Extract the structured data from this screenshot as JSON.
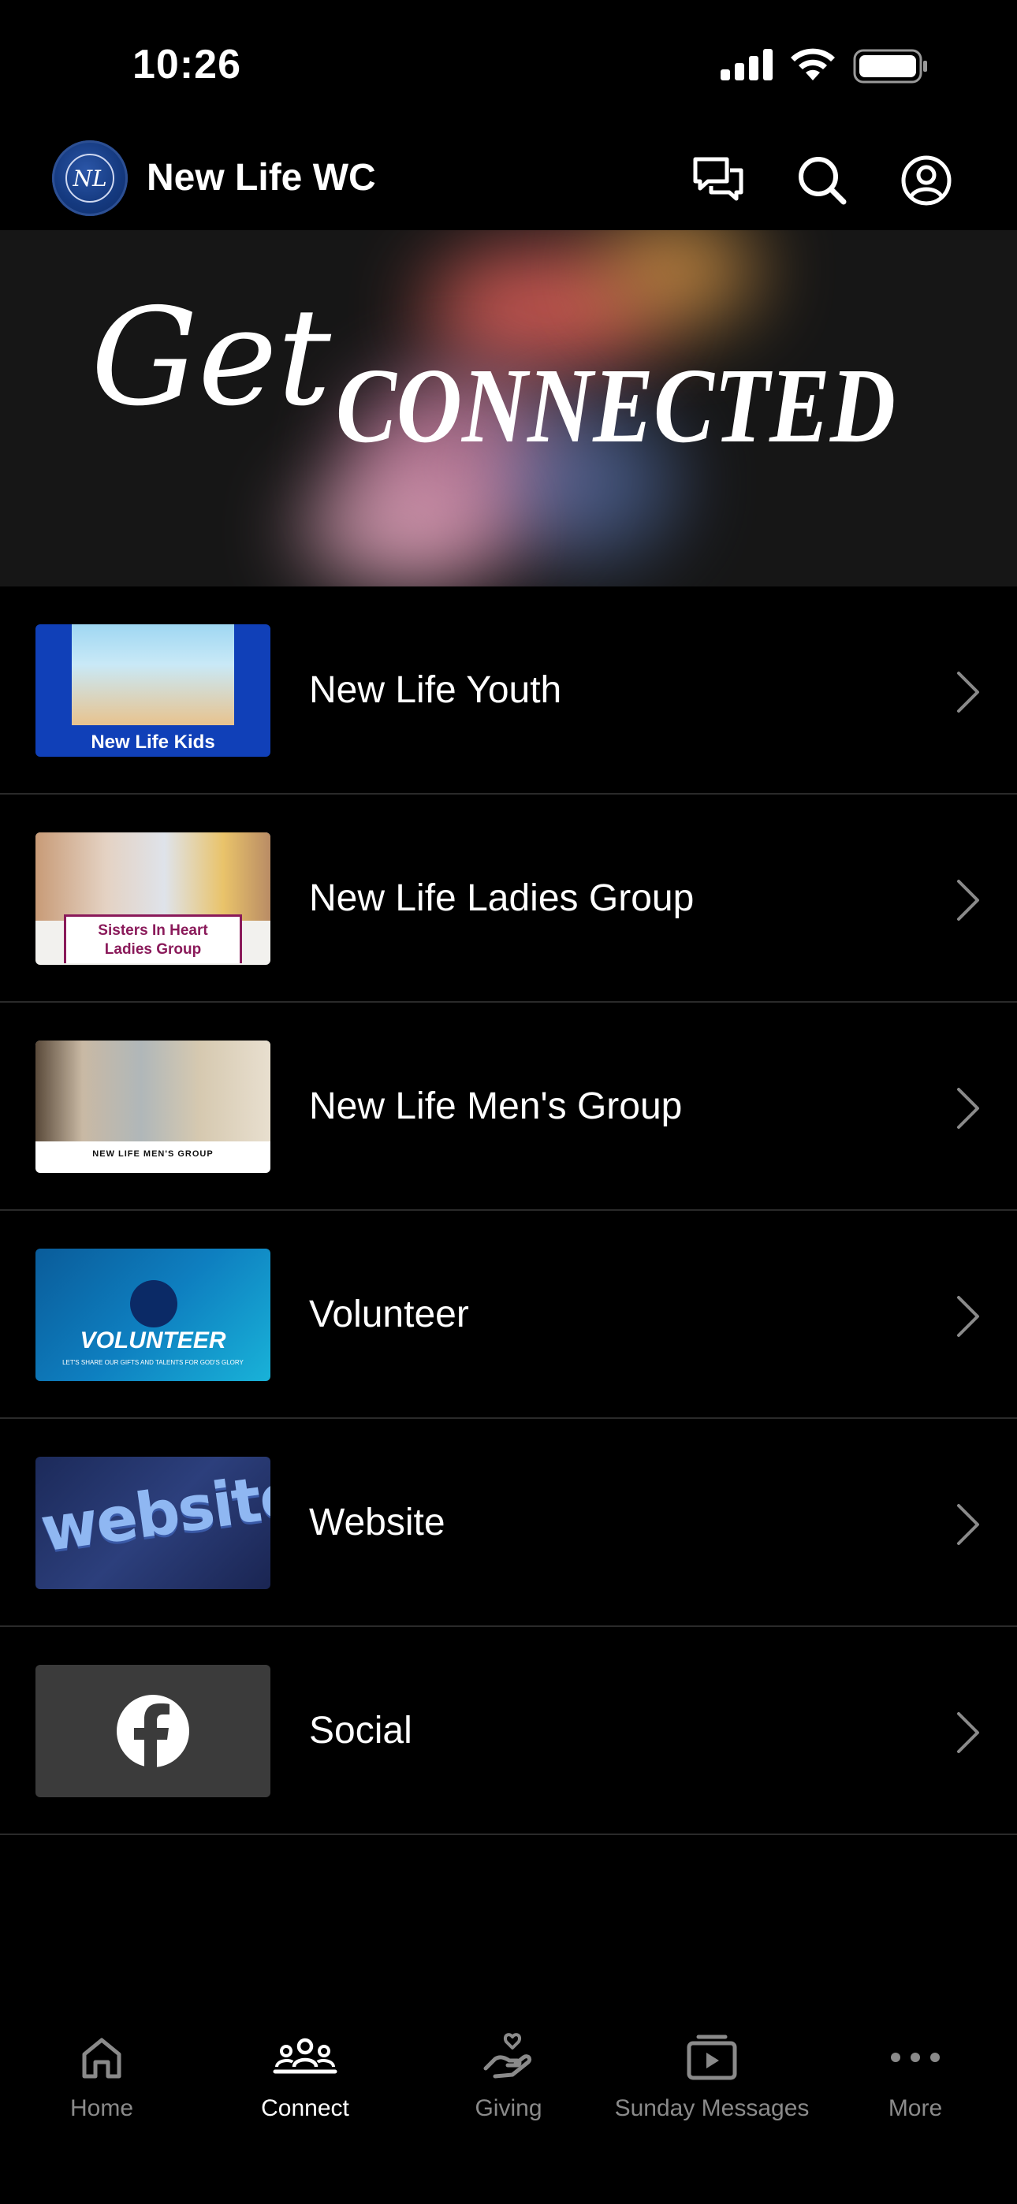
{
  "status_bar": {
    "time": "10:26"
  },
  "header": {
    "title": "New Life WC",
    "logo_text": "NL"
  },
  "banner": {
    "script_word": "Get",
    "caps_word": "CONNECTED"
  },
  "items": [
    {
      "label": "New Life Youth",
      "thumb_caption": "New Life Kids"
    },
    {
      "label": "New Life Ladies Group",
      "thumb_caption_line1": "Sisters In Heart",
      "thumb_caption_line2": "Ladies Group"
    },
    {
      "label": "New Life Men's Group",
      "thumb_caption": "NEW LIFE MEN'S GROUP"
    },
    {
      "label": "Volunteer",
      "thumb_caption": "VOLUNTEER",
      "thumb_subcaption": "LET'S SHARE OUR GIFTS AND TALENTS FOR GOD'S GLORY"
    },
    {
      "label": "Website",
      "thumb_caption": "website"
    },
    {
      "label": "Social",
      "thumb_icon": "facebook-icon"
    }
  ],
  "tabs": [
    {
      "label": "Home",
      "icon": "home-icon",
      "active": false
    },
    {
      "label": "Connect",
      "icon": "people-icon",
      "active": true
    },
    {
      "label": "Giving",
      "icon": "giving-hand-icon",
      "active": false
    },
    {
      "label": "Sunday Messages",
      "icon": "video-stack-icon",
      "active": false
    },
    {
      "label": "More",
      "icon": "ellipsis-icon",
      "active": false
    }
  ],
  "colors": {
    "background": "#000000",
    "inactive_tab": "#8a8a8a",
    "divider": "#2a2a2a"
  }
}
